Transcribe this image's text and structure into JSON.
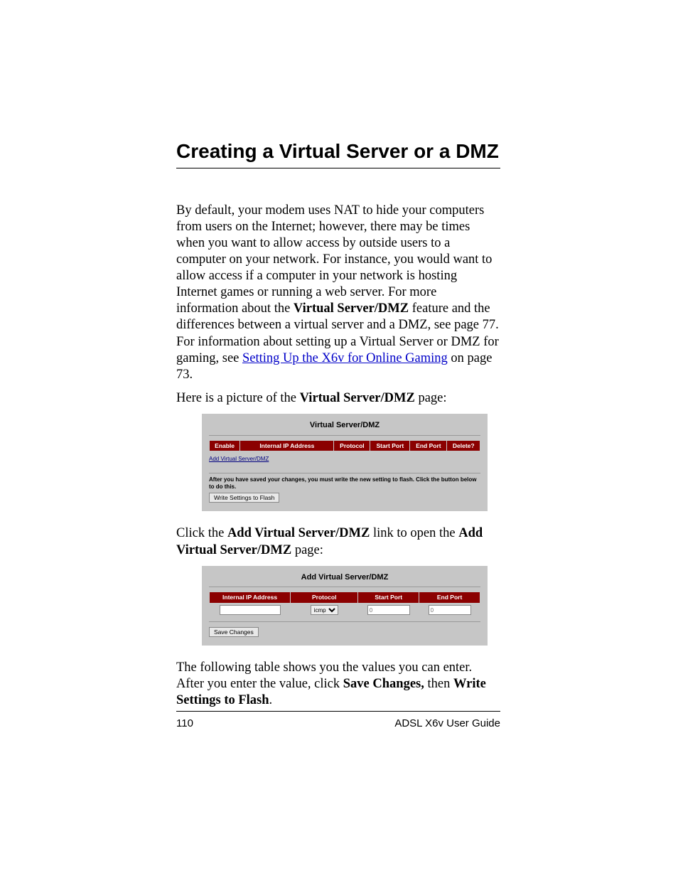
{
  "heading": "Creating a Virtual Server or a DMZ",
  "para1": {
    "t1": "By default, your modem uses NAT to hide your computers from users on the Internet; however, there may be times when you want to allow access by outside users to a computer on your network. For instance, you would want to allow access if a computer in your network is hosting Internet games or running a web server. For more information about the ",
    "b1": "Virtual Server/DMZ",
    "t2": " feature and the differences between a virtual server and a DMZ, see page 77. For information about setting up a Virtual Server or DMZ for gaming, see ",
    "link": "Setting Up the X6v for Online Gaming",
    "t3": " on page 73."
  },
  "para2": {
    "t1": "Here is a picture of the ",
    "b1": "Virtual Server/DMZ",
    "t2": " page:"
  },
  "panel1": {
    "title": "Virtual Server/DMZ",
    "headers": [
      "Enable",
      "Internal IP Address",
      "Protocol",
      "Start Port",
      "End Port",
      "Delete?"
    ],
    "add_link": "Add Virtual Server/DMZ",
    "flash_note": "After you have saved your changes, you must write the new setting to flash. Click the button below to do this.",
    "flash_btn": "Write Settings to Flash"
  },
  "para3": {
    "t1": "Click the ",
    "b1": "Add Virtual Server/DMZ",
    "t2": " link to open the ",
    "b2": "Add Virtual Server/DMZ",
    "t3": " page:"
  },
  "panel2": {
    "title": "Add Virtual Server/DMZ",
    "headers": [
      "Internal IP Address",
      "Protocol",
      "Start Port",
      "End Port"
    ],
    "protocol_value": "icmp",
    "port_placeholder": "0",
    "save_btn": "Save Changes"
  },
  "para4": {
    "t1": "The following table shows you the values you can enter. After you enter the value, click ",
    "b1": "Save Changes,",
    "t2": " then ",
    "b2": "Write Settings to Flash",
    "t3": "."
  },
  "footer": {
    "page_num": "110",
    "guide": "ADSL X6v User Guide"
  }
}
